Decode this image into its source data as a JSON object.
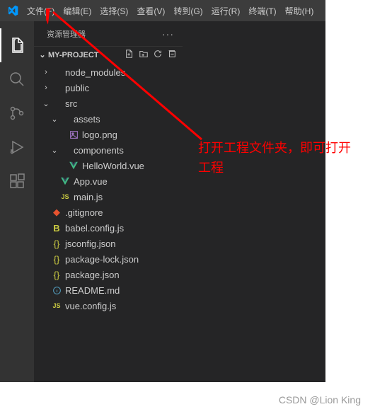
{
  "menubar": {
    "items": [
      "文件(F)",
      "编辑(E)",
      "选择(S)",
      "查看(V)",
      "转到(G)",
      "运行(R)",
      "终端(T)",
      "帮助(H)"
    ]
  },
  "sidebar": {
    "title": "资源管理器",
    "project_name": "MY-PROJECT",
    "tree": [
      {
        "depth": 0,
        "chev": "›",
        "icon": "folder",
        "label": "node_modules"
      },
      {
        "depth": 0,
        "chev": "›",
        "icon": "folder",
        "label": "public"
      },
      {
        "depth": 0,
        "chev": "⌄",
        "icon": "folder",
        "label": "src"
      },
      {
        "depth": 1,
        "chev": "⌄",
        "icon": "folder",
        "label": "assets"
      },
      {
        "depth": 2,
        "chev": "",
        "icon": "img",
        "label": "logo.png"
      },
      {
        "depth": 1,
        "chev": "⌄",
        "icon": "folder",
        "label": "components"
      },
      {
        "depth": 2,
        "chev": "",
        "icon": "vue",
        "label": "HelloWorld.vue"
      },
      {
        "depth": 1,
        "chev": "",
        "icon": "vue",
        "label": "App.vue"
      },
      {
        "depth": 1,
        "chev": "",
        "icon": "js",
        "label": "main.js"
      },
      {
        "depth": 0,
        "chev": "",
        "icon": "git",
        "label": ".gitignore"
      },
      {
        "depth": 0,
        "chev": "",
        "icon": "babel",
        "label": "babel.config.js"
      },
      {
        "depth": 0,
        "chev": "",
        "icon": "json",
        "label": "jsconfig.json"
      },
      {
        "depth": 0,
        "chev": "",
        "icon": "json",
        "label": "package-lock.json"
      },
      {
        "depth": 0,
        "chev": "",
        "icon": "json",
        "label": "package.json"
      },
      {
        "depth": 0,
        "chev": "",
        "icon": "info",
        "label": "README.md"
      },
      {
        "depth": 0,
        "chev": "",
        "icon": "js",
        "label": "vue.config.js"
      }
    ]
  },
  "action_icons": {
    "new_file": "新建文件",
    "new_folder": "新建文件夹",
    "refresh": "刷新",
    "collapse": "折叠"
  },
  "annotation": "打开工程文件夹，即可打开工程",
  "watermark": "CSDN @Lion King",
  "colors": {
    "bg_dark": "#252526",
    "bg_darker": "#333333",
    "menubar": "#3c3c3c",
    "text": "#cccccc",
    "accent_red": "#ff0000"
  }
}
